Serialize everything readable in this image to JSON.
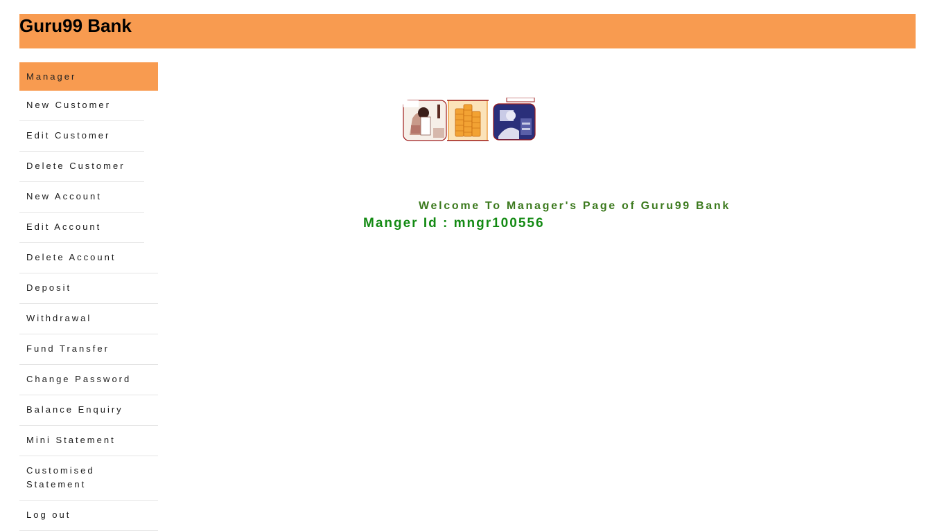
{
  "header": {
    "brand": "Guru99 Bank"
  },
  "menu": {
    "items": [
      {
        "label": "Manager"
      },
      {
        "label": "New Customer"
      },
      {
        "label": "Edit Customer"
      },
      {
        "label": "Delete Customer"
      },
      {
        "label": "New Account"
      },
      {
        "label": "Edit Account"
      },
      {
        "label": "Delete Account"
      },
      {
        "label": "Deposit"
      },
      {
        "label": "Withdrawal"
      },
      {
        "label": "Fund Transfer"
      },
      {
        "label": "Change Password"
      },
      {
        "label": "Balance Enquiry"
      },
      {
        "label": "Mini Statement"
      },
      {
        "label": "Customised Statement"
      },
      {
        "label": "Log out"
      }
    ]
  },
  "main": {
    "welcome": "Welcome To Manager's Page of Guru99 Bank",
    "manager_id": "Manger Id : mngr100556",
    "banner_icons": [
      "phone-call-photo",
      "coin-stack-photo",
      "customer-service-photo"
    ]
  },
  "colors": {
    "accent": "#f89b50",
    "welcome_text": "#3c7a1e",
    "manager_id_text": "#138a13"
  }
}
